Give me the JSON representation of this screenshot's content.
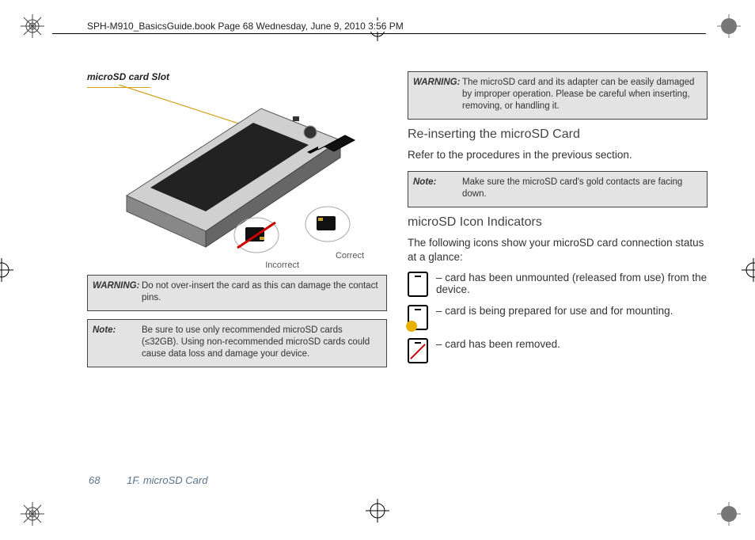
{
  "header": {
    "line": "SPH-M910_BasicsGuide.book  Page 68  Wednesday, June 9, 2010  3:56 PM"
  },
  "left": {
    "slot_label": "microSD card Slot",
    "illustration": {
      "correct_label": "Correct",
      "incorrect_label": "Incorrect"
    },
    "warning1": {
      "label": "WARNING:",
      "text": "Do not over-insert the card as this can damage the contact pins."
    },
    "note1": {
      "label": "Note:",
      "text": "Be sure to use only recommended microSD cards (≤32GB). Using non-recommended microSD cards could cause data loss and damage your device."
    }
  },
  "right": {
    "warning2": {
      "label": "WARNING:",
      "text": "The microSD card and its adapter can be easily damaged by improper operation. Please be careful when inserting, removing, or handling it."
    },
    "heading_reinsert": "Re-inserting the microSD Card",
    "para_reinsert": "Refer to the procedures in the previous section.",
    "note2": {
      "label": "Note:",
      "text": "Make sure the microSD card's gold contacts are facing down."
    },
    "heading_icons": "microSD Icon Indicators",
    "para_icons": "The following icons show your microSD card connection status at a glance:",
    "icons": [
      {
        "name": "sd-unmounted-icon",
        "text": "– card has been unmounted (released from use) from the device."
      },
      {
        "name": "sd-preparing-icon",
        "text": "– card is being prepared for use and for mounting."
      },
      {
        "name": "sd-removed-icon",
        "text": "– card has been removed."
      }
    ]
  },
  "footer": {
    "page_number": "68",
    "section": "1F. microSD Card"
  }
}
